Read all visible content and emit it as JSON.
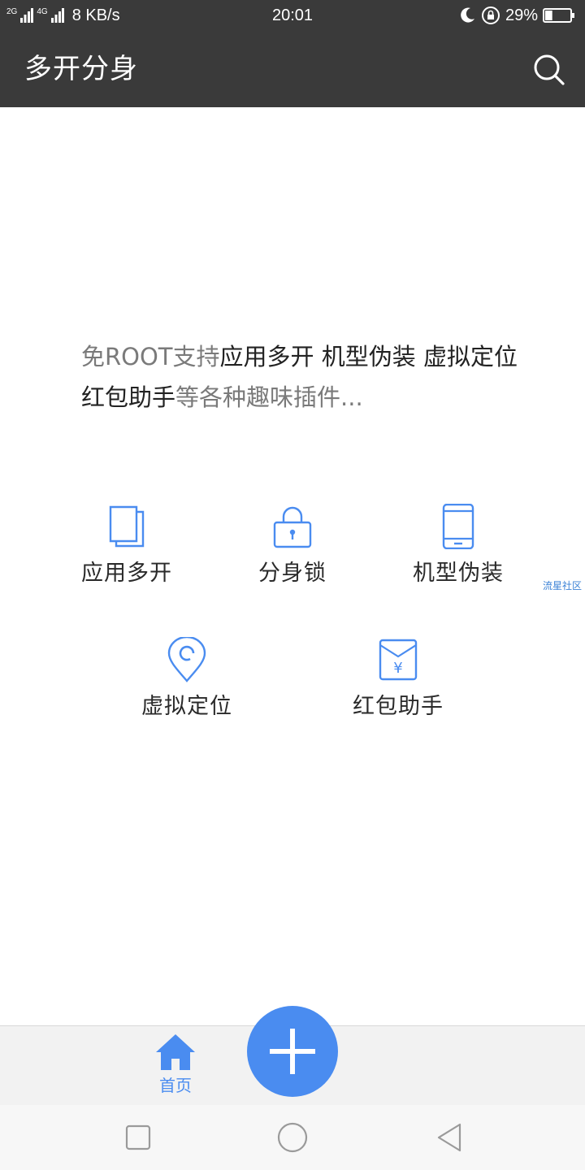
{
  "status_bar": {
    "net_2g": "2G",
    "net_4g": "4G",
    "speed": "8 KB/s",
    "time": "20:01",
    "battery_percent": "29%",
    "battery_level": 0.29,
    "icons": [
      "signal-icon",
      "moon-icon",
      "rotation-lock-icon",
      "battery-icon"
    ]
  },
  "app_bar": {
    "title": "多开分身",
    "search_icon": "search-icon"
  },
  "intro": {
    "parts": [
      {
        "text": "免ROOT支持",
        "highlight": false
      },
      {
        "text": "应用多开 机型伪装 虚拟定位 红包助手",
        "highlight": true
      },
      {
        "text": "等各种趣味插件...",
        "highlight": false
      }
    ]
  },
  "features": [
    {
      "label": "应用多开",
      "icon": "copy-icon"
    },
    {
      "label": "分身锁",
      "icon": "lock-icon"
    },
    {
      "label": "机型伪装",
      "icon": "phone-icon"
    },
    {
      "label": "虚拟定位",
      "icon": "location-pin-icon"
    },
    {
      "label": "红包助手",
      "icon": "red-envelope-icon"
    }
  ],
  "watermark": "流星社区",
  "bottom_nav": {
    "home_label": "首页",
    "home_icon": "home-icon",
    "fab_icon": "plus-icon"
  },
  "system_nav": {
    "icons": [
      "recent-apps-icon",
      "home-circle-icon",
      "back-icon"
    ]
  },
  "colors": {
    "accent": "#4a8cf0",
    "bar_background": "#3a3a3a",
    "icon_outline": "#4a8cf0"
  }
}
